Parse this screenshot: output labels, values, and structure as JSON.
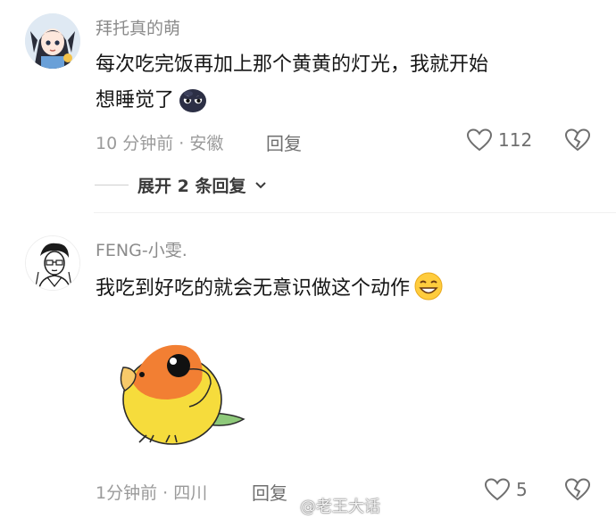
{
  "comments": [
    {
      "username": "拜托真的萌",
      "text": "每次吃完饭再加上那个黄黄的灯光，我就开始想睡觉了",
      "emoji": "sleepy-blob-emoji",
      "time_location": "10 分钟前 · 安徽",
      "reply_label": "回复",
      "like_count": "112",
      "expand_label": "展开 2 条回复"
    },
    {
      "username": "FENG-小雯.",
      "text": "我吃到好吃的就会无意识做这个动作",
      "emoji": "grin-emoji",
      "time_location": "1分钟前 · 四川",
      "reply_label": "回复",
      "like_count": "5"
    }
  ],
  "icons": {
    "like": "heart-outline-icon",
    "dislike": "broken-heart-outline-icon",
    "expand": "chevron-down-icon"
  },
  "watermark": "@老王大话",
  "colors": {
    "meta_gray": "#9a9a9a",
    "parrot_yellow": "#f5d83a",
    "parrot_orange": "#f07a32"
  }
}
